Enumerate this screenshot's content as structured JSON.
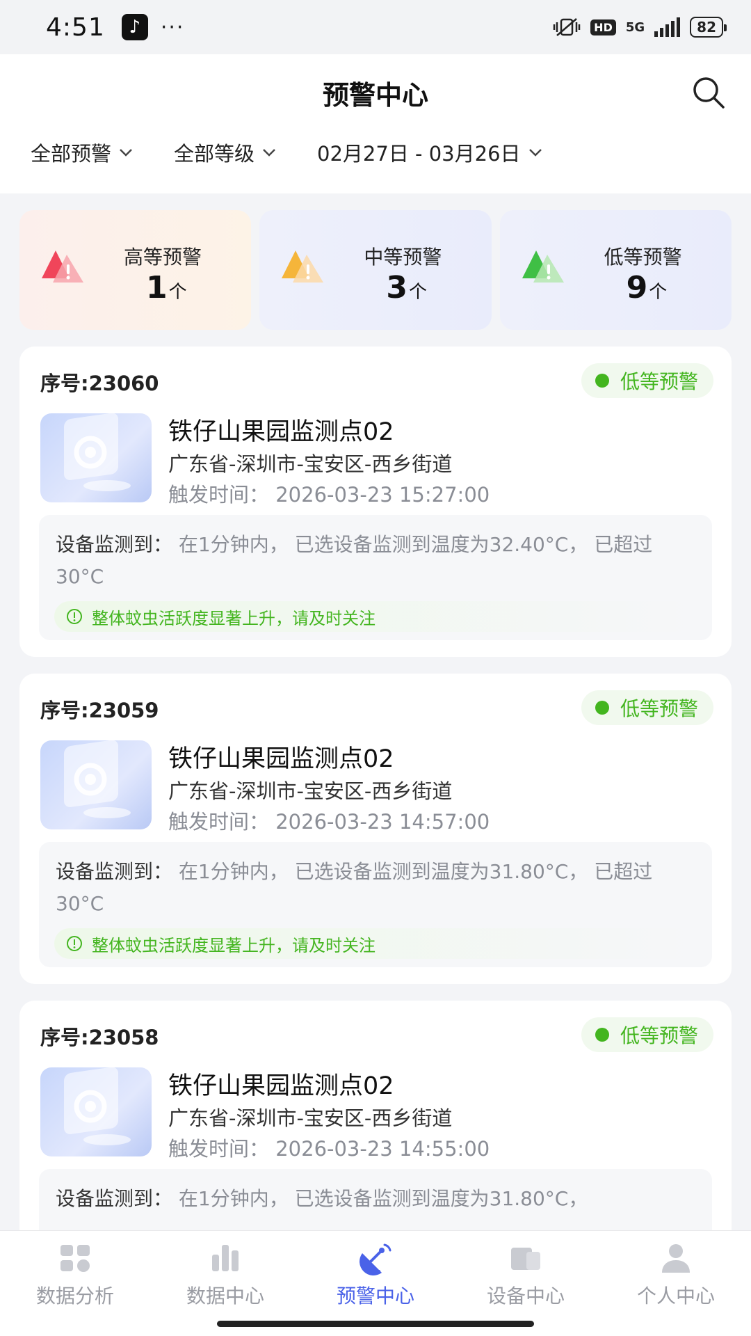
{
  "status_bar": {
    "time": "4:51",
    "dots": "···",
    "hd": "HD",
    "network": "5G",
    "battery": "82"
  },
  "header": {
    "title": "预警中心",
    "filters": [
      {
        "label": "全部预警"
      },
      {
        "label": "全部等级"
      },
      {
        "label": "02月27日 - 03月26日"
      }
    ]
  },
  "stats": [
    {
      "label": "高等预警",
      "count": "1",
      "unit": "个",
      "color": "#f0455a"
    },
    {
      "label": "中等预警",
      "count": "3",
      "unit": "个",
      "color": "#f5b53a"
    },
    {
      "label": "低等预警",
      "count": "9",
      "unit": "个",
      "color": "#3fbf45"
    }
  ],
  "alerts": [
    {
      "serial": "序号:23060",
      "level": "低等预警",
      "site": "铁仔山果园监测点02",
      "region": "广东省-深圳市-宝安区-西乡街道",
      "trigger_time": "触发时间： 2026-03-23 15:27:00",
      "detail_prefix": "设备监测到：",
      "detail": "在1分钟内， 已选设备监测到温度为32.40°C， 已超过 30°C",
      "tip": "整体蚊虫活跃度显著上升，请及时关注"
    },
    {
      "serial": "序号:23059",
      "level": "低等预警",
      "site": "铁仔山果园监测点02",
      "region": "广东省-深圳市-宝安区-西乡街道",
      "trigger_time": "触发时间： 2026-03-23 14:57:00",
      "detail_prefix": "设备监测到：",
      "detail": "在1分钟内， 已选设备监测到温度为31.80°C， 已超过 30°C",
      "tip": "整体蚊虫活跃度显著上升，请及时关注"
    },
    {
      "serial": "序号:23058",
      "level": "低等预警",
      "site": "铁仔山果园监测点02",
      "region": "广东省-深圳市-宝安区-西乡街道",
      "trigger_time": "触发时间： 2026-03-23 14:55:00",
      "detail_prefix": "设备监测到：",
      "detail": "在1分钟内， 已选设备监测到温度为31.80°C，",
      "tip": ""
    }
  ],
  "tabbar": {
    "tabs": [
      {
        "label": "数据分析",
        "icon": "data-analysis-icon"
      },
      {
        "label": "数据中心",
        "icon": "bar-chart-icon"
      },
      {
        "label": "预警中心",
        "icon": "satellite-dish-icon",
        "active": true
      },
      {
        "label": "设备中心",
        "icon": "devices-icon"
      },
      {
        "label": "个人中心",
        "icon": "person-icon"
      }
    ]
  },
  "colors": {
    "accent": "#4a62e8",
    "low_level": "#43b51f"
  }
}
